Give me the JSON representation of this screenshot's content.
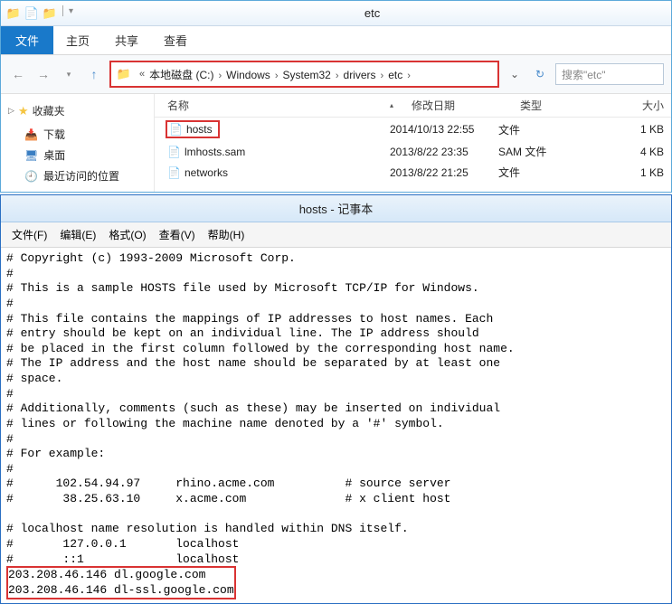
{
  "explorer": {
    "title": "etc",
    "file_tab": "文件",
    "tabs": [
      "主页",
      "共享",
      "查看"
    ],
    "breadcrumbs": [
      "本地磁盘 (C:)",
      "Windows",
      "System32",
      "drivers",
      "etc"
    ],
    "search_placeholder": "搜索\"etc\"",
    "sidebar": {
      "favorites": "收藏夹",
      "items": [
        {
          "label": "下载",
          "icon": "dl-ico"
        },
        {
          "label": "桌面",
          "icon": "desk-ico"
        },
        {
          "label": "最近访问的位置",
          "icon": "recent-ico"
        }
      ]
    },
    "columns": {
      "name": "名称",
      "date": "修改日期",
      "type": "类型",
      "size": "大小"
    },
    "files": [
      {
        "name": "hosts",
        "date": "2014/10/13 22:55",
        "type": "文件",
        "size": "1 KB",
        "highlight": true
      },
      {
        "name": "lmhosts.sam",
        "date": "2013/8/22 23:35",
        "type": "SAM 文件",
        "size": "4 KB"
      },
      {
        "name": "networks",
        "date": "2013/8/22 21:25",
        "type": "文件",
        "size": "1 KB"
      }
    ]
  },
  "notepad": {
    "title": "hosts - 记事本",
    "menu": [
      "文件(F)",
      "编辑(E)",
      "格式(O)",
      "查看(V)",
      "帮助(H)"
    ],
    "body_top": "# Copyright (c) 1993-2009 Microsoft Corp.\n#\n# This is a sample HOSTS file used by Microsoft TCP/IP for Windows.\n#\n# This file contains the mappings of IP addresses to host names. Each\n# entry should be kept on an individual line. The IP address should\n# be placed in the first column followed by the corresponding host name.\n# The IP address and the host name should be separated by at least one\n# space.\n#\n# Additionally, comments (such as these) may be inserted on individual\n# lines or following the machine name denoted by a '#' symbol.\n#\n# For example:\n#\n#      102.54.94.97     rhino.acme.com          # source server\n#       38.25.63.10     x.acme.com              # x client host\n\n# localhost name resolution is handled within DNS itself.\n#\t127.0.0.1       localhost\n#\t::1             localhost",
    "body_highlight": "203.208.46.146 dl.google.com\n203.208.46.146 dl-ssl.google.com"
  }
}
